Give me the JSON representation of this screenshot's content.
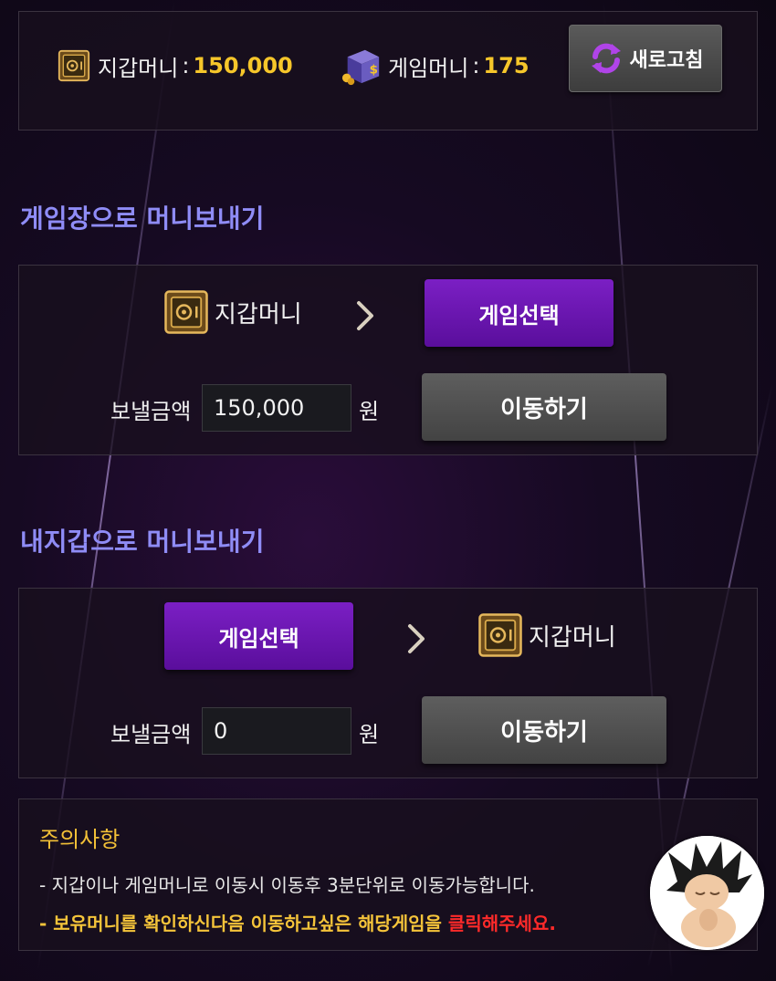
{
  "wallet": {
    "wallet_money_label": "지갑머니",
    "wallet_money_value": "150,000",
    "game_money_label": "게임머니",
    "game_money_value": "175",
    "colon": ":",
    "refresh_label": "새로고침"
  },
  "send_to_game": {
    "title": "게임장으로 머니보내기",
    "from_label": "지갑머니",
    "select_game_label": "게임선택",
    "amount_label": "보낼금액",
    "amount_value": "150,000",
    "unit": "원",
    "move_label": "이동하기"
  },
  "send_to_wallet": {
    "title": "내지갑으로 머니보내기",
    "select_game_label": "게임선택",
    "to_label": "지갑머니",
    "amount_label": "보낼금액",
    "amount_value": "0",
    "unit": "원",
    "move_label": "이동하기"
  },
  "notice": {
    "title": "주의사항",
    "line1": "- 지갑이나 게임머니로 이동시 이동후 3분단위로 이동가능합니다.",
    "line2_prefix": "- 보유머니를 확인하신다음 이동하고싶은 해당게임을 ",
    "line2_red": "클릭해주세요."
  },
  "colors": {
    "accent_purple": "#7b1fc4",
    "title_purple": "#8f8cf6",
    "money_yellow": "#f6c62a",
    "notice_red": "#ff2a2a"
  },
  "icons": [
    "safe-icon",
    "game-box-icon",
    "refresh-icon",
    "chevron-right-icon",
    "avatar"
  ]
}
